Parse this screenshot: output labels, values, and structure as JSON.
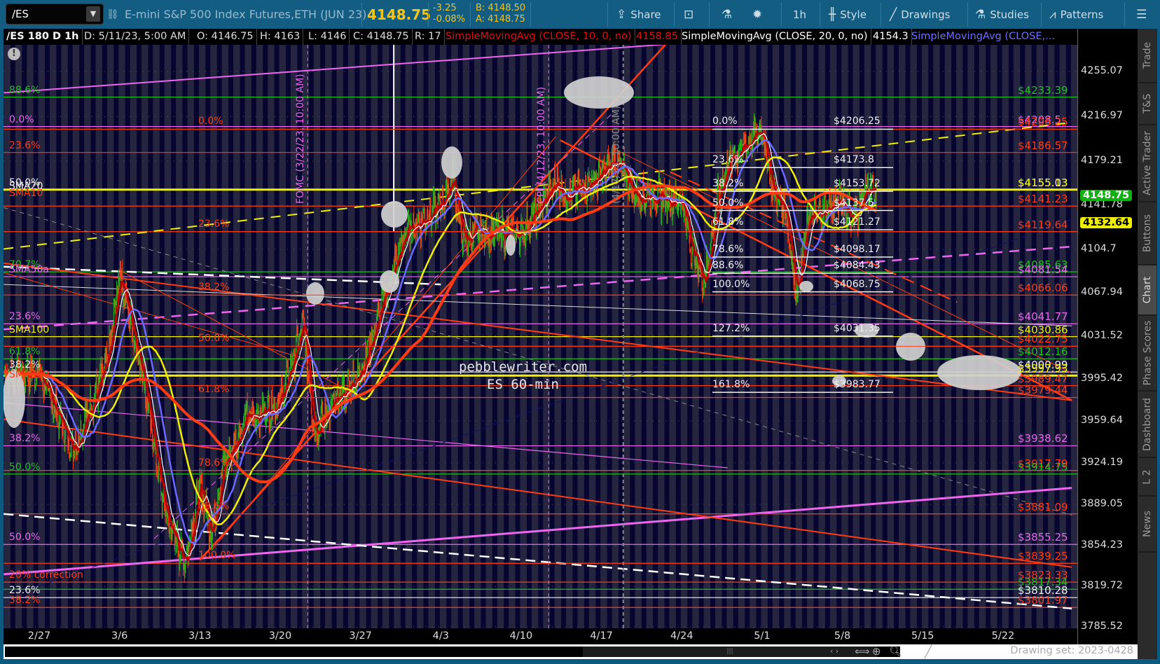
{
  "toolbar": {
    "symbol": "/ES",
    "description": "E-mini S&P 500 Index Futures,ETH (JUN 23)",
    "last": "4148.75",
    "change": "-3.25",
    "change_pct": "-0.08%",
    "bid": "B: 4148.50",
    "ask": "A: 4148.75",
    "share": "Share",
    "timeframe": "1h",
    "style": "Style",
    "drawings": "Drawings",
    "studies": "Studies",
    "patterns": "Patterns"
  },
  "legend": {
    "title": "/ES 180 D 1h",
    "date": "D: 5/11/23, 5:00 AM",
    "open": "O: 4146.75",
    "high": "H: 4163",
    "low": "L: 4146",
    "close": "C: 4148.75",
    "range": "R: 17",
    "sma10": "SimpleMovingAvg (CLOSE, 10, 0, no)",
    "sma10_val": "4158.85",
    "sma20": "SimpleMovingAvg (CLOSE, 20, 0, no)",
    "sma20_val": "4154.3",
    "sma_other": "SimpleMovingAvg (CLOSE,..."
  },
  "colors": {
    "green": "#1fc01f",
    "red": "#ff3b14",
    "magenta": "#ee66ee",
    "white": "#f0f0f0",
    "yellow": "#f0f000",
    "blue": "#6a6aff",
    "darkred": "#c00000"
  },
  "tabs": [
    "Trade",
    "T&S",
    "Active Trader",
    "Buttons",
    "Chart",
    "Phase Scores",
    "Dashboard",
    "L 2",
    "News"
  ],
  "active_tab": "Chart",
  "bottom": {
    "drawing_set": "Drawing set: 2023-0428"
  },
  "watermark": {
    "line1": "pebblewriter.com",
    "line2": "ES 60-min"
  },
  "chart_data": {
    "type": "candlestick",
    "symbol": "/ES",
    "interval": "1h",
    "ylim": [
      3785.52,
      4255.07
    ],
    "y_ticks": [
      "4255.07",
      "4216.97",
      "4179.21",
      "4141.78",
      "4104.7",
      "4067.94",
      "4031.52",
      "3995.42",
      "3959.64",
      "3924.19",
      "3889.05",
      "3854.23",
      "3819.72",
      "3785.52"
    ],
    "x_ticks": [
      {
        "label": "2/27",
        "day": 0
      },
      {
        "label": "3/6",
        "day": 7
      },
      {
        "label": "3/13",
        "day": 14
      },
      {
        "label": "3/20",
        "day": 21
      },
      {
        "label": "3/27",
        "day": 28
      },
      {
        "label": "4/3",
        "day": 35
      },
      {
        "label": "4/10",
        "day": 42
      },
      {
        "label": "4/17",
        "day": 49
      },
      {
        "label": "4/24",
        "day": 56
      },
      {
        "label": "5/1",
        "day": 63
      },
      {
        "label": "5/8",
        "day": 70
      },
      {
        "label": "5/15",
        "day": 77
      },
      {
        "label": "5/22",
        "day": 84
      }
    ],
    "price_badges": [
      {
        "value": "4148.75",
        "color": "green",
        "price": 4148.75
      },
      {
        "value": "4132.64",
        "color": "yellow",
        "price": 4132.64
      }
    ],
    "price_path": [
      [
        -3,
        4000
      ],
      [
        0,
        4000
      ],
      [
        3,
        3935
      ],
      [
        6,
        4010
      ],
      [
        7,
        4085
      ],
      [
        9,
        4000
      ],
      [
        11,
        3880
      ],
      [
        12.7,
        3839
      ],
      [
        14,
        3905
      ],
      [
        15,
        3865
      ],
      [
        16,
        3920
      ],
      [
        18,
        3960
      ],
      [
        21,
        3975
      ],
      [
        23,
        4040
      ],
      [
        24,
        3950
      ],
      [
        25,
        3965
      ],
      [
        28,
        4000
      ],
      [
        30,
        4060
      ],
      [
        32,
        4120
      ],
      [
        35,
        4140
      ],
      [
        36,
        4165
      ],
      [
        37,
        4110
      ],
      [
        38,
        4120
      ],
      [
        42,
        4118
      ],
      [
        43,
        4130
      ],
      [
        45,
        4160
      ],
      [
        46,
        4150
      ],
      [
        49,
        4165
      ],
      [
        50,
        4180
      ],
      [
        51,
        4170
      ],
      [
        52,
        4150
      ],
      [
        53,
        4150
      ],
      [
        56,
        4145
      ],
      [
        57,
        4100
      ],
      [
        58,
        4078
      ],
      [
        59,
        4140
      ],
      [
        60,
        4178
      ],
      [
        63,
        4206
      ],
      [
        64,
        4150
      ],
      [
        65,
        4140
      ],
      [
        66,
        4068
      ],
      [
        67,
        4130
      ],
      [
        70,
        4145
      ],
      [
        71,
        4128
      ],
      [
        72,
        4155
      ],
      [
        73,
        4148.75
      ]
    ],
    "levels": [
      {
        "label": "$4233.39",
        "price": 4233.39,
        "color": "green"
      },
      {
        "label": "$4208.5",
        "price": 4208.5,
        "color": "magenta"
      },
      {
        "label": "$4206.25",
        "price": 4206.25,
        "color": "red"
      },
      {
        "label": "$4186.57",
        "price": 4186.57,
        "color": "red"
      },
      {
        "label": "$4155.03",
        "price": 4155.03,
        "color": "white"
      },
      {
        "label": "$4155.13",
        "price": 4155.13,
        "color": "yellow"
      },
      {
        "label": "$4141.23",
        "price": 4141.23,
        "color": "red"
      },
      {
        "label": "$4119.64",
        "price": 4119.64,
        "color": "red"
      },
      {
        "label": "$4085.63",
        "price": 4085.63,
        "color": "green"
      },
      {
        "label": "$4081.54",
        "price": 4081.54,
        "color": "magenta"
      },
      {
        "label": "$4066.06",
        "price": 4066.06,
        "color": "red"
      },
      {
        "label": "$4041.77",
        "price": 4041.77,
        "color": "magenta"
      },
      {
        "label": "$4030.86",
        "price": 4030.86,
        "color": "yellow"
      },
      {
        "label": "$4022.75",
        "price": 4022.75,
        "color": "red"
      },
      {
        "label": "$4012.16",
        "price": 4012.16,
        "color": "green"
      },
      {
        "label": "$4000.99",
        "price": 4000.99,
        "color": "white"
      },
      {
        "label": "$3997.93",
        "price": 3997.93,
        "color": "yellow"
      },
      {
        "label": "$3989.47",
        "price": 3989.47,
        "color": "red"
      },
      {
        "label": "$3979.44",
        "price": 3979.44,
        "color": "red"
      },
      {
        "label": "$3938.62",
        "price": 3938.62,
        "color": "magenta"
      },
      {
        "label": "$3917.79",
        "price": 3917.79,
        "color": "red"
      },
      {
        "label": "$3914.75",
        "price": 3914.75,
        "color": "green"
      },
      {
        "label": "$3881.09",
        "price": 3881.09,
        "color": "red"
      },
      {
        "label": "$3855.25",
        "price": 3855.25,
        "color": "magenta"
      },
      {
        "label": "$3839.25",
        "price": 3839.25,
        "color": "red"
      },
      {
        "label": "$3823.33",
        "price": 3823.33,
        "color": "red"
      },
      {
        "label": "$3817.34",
        "price": 3817.34,
        "color": "green"
      },
      {
        "label": "$3810.28",
        "price": 3810.28,
        "color": "white"
      },
      {
        "label": "$3801.97",
        "price": 3801.97,
        "color": "red"
      }
    ],
    "left_labels": [
      {
        "text": "88.6%",
        "price": 4233.39,
        "color": "green"
      },
      {
        "text": "0.0%",
        "price": 4208.5,
        "color": "magenta"
      },
      {
        "text": "23.6%",
        "price": 4186.57,
        "color": "red"
      },
      {
        "text": "50.0%",
        "price": 4155.1,
        "color": "white"
      },
      {
        "text": "SMA20",
        "price": 4152,
        "color": "white"
      },
      {
        "text": "SMA10",
        "price": 4146,
        "color": "red"
      },
      {
        "text": "70.7%",
        "price": 4085.63,
        "color": "green"
      },
      {
        "text": "SMA50a",
        "price": 4081.54,
        "color": "magenta"
      },
      {
        "text": "23.6%",
        "price": 4041.77,
        "color": "magenta"
      },
      {
        "text": "SMA100",
        "price": 4030.86,
        "color": "yellow"
      },
      {
        "text": "61.8%",
        "price": 4012.16,
        "color": "green"
      },
      {
        "text": "38.2%",
        "price": 4000.99,
        "color": "white"
      },
      {
        "text": "SMA200",
        "price": 3993,
        "color": "red"
      },
      {
        "text": "38.2%",
        "price": 3938.62,
        "color": "magenta"
      },
      {
        "text": "50.0%",
        "price": 3914.75,
        "color": "green"
      },
      {
        "text": "50.0%",
        "price": 3855.25,
        "color": "magenta"
      },
      {
        "text": "20% correction",
        "price": 3823.33,
        "color": "red"
      },
      {
        "text": "23.6%",
        "price": 3810.28,
        "color": "white"
      },
      {
        "text": "38.2%",
        "price": 3801.97,
        "color": "red"
      }
    ],
    "fib_red": [
      {
        "text": "0.0%",
        "price": 4206.25
      },
      {
        "text": "23.6%",
        "price": 4119.64
      },
      {
        "text": "38.2%",
        "price": 4066.06
      },
      {
        "text": "50.0%",
        "price": 4022.75
      },
      {
        "text": "61.8%",
        "price": 3979.44
      },
      {
        "text": "78.6%",
        "price": 3917.79
      },
      {
        "text": "88.6%",
        "price": 3881.09
      },
      {
        "text": "100.0%",
        "price": 3839.25
      }
    ],
    "fib_white": [
      {
        "text": "0.0%",
        "value": "$4206.25",
        "price": 4206.25
      },
      {
        "text": "23.6%",
        "value": "$4173.8",
        "price": 4173.8
      },
      {
        "text": "38.2%",
        "value": "$4153.72",
        "price": 4153.72
      },
      {
        "text": "50.0%",
        "value": "$4137.5",
        "price": 4137.5
      },
      {
        "text": "61.8%",
        "value": "$4121.27",
        "price": 4121.27
      },
      {
        "text": "78.6%",
        "value": "$4098.17",
        "price": 4098.17
      },
      {
        "text": "88.6%",
        "value": "$4084.43",
        "price": 4084.43
      },
      {
        "text": "100.0%",
        "value": "$4068.75",
        "price": 4068.75
      },
      {
        "text": "127.2%",
        "value": "$4031.35",
        "price": 4031.35
      },
      {
        "text": "161.8%",
        "value": "$3983.77",
        "price": 3983.77
      }
    ],
    "events": [
      {
        "text": "FOMC (3/22/23, 10:00 AM)",
        "day": 23.4,
        "color": "magenta"
      },
      {
        "text": "CPI (4/12/23, 10:00 AM)",
        "day": 44.4,
        "color": "magenta"
      },
      {
        "text": "(4/17/23, 10:00 AM)",
        "day": 50.9,
        "color": "gray"
      }
    ]
  }
}
